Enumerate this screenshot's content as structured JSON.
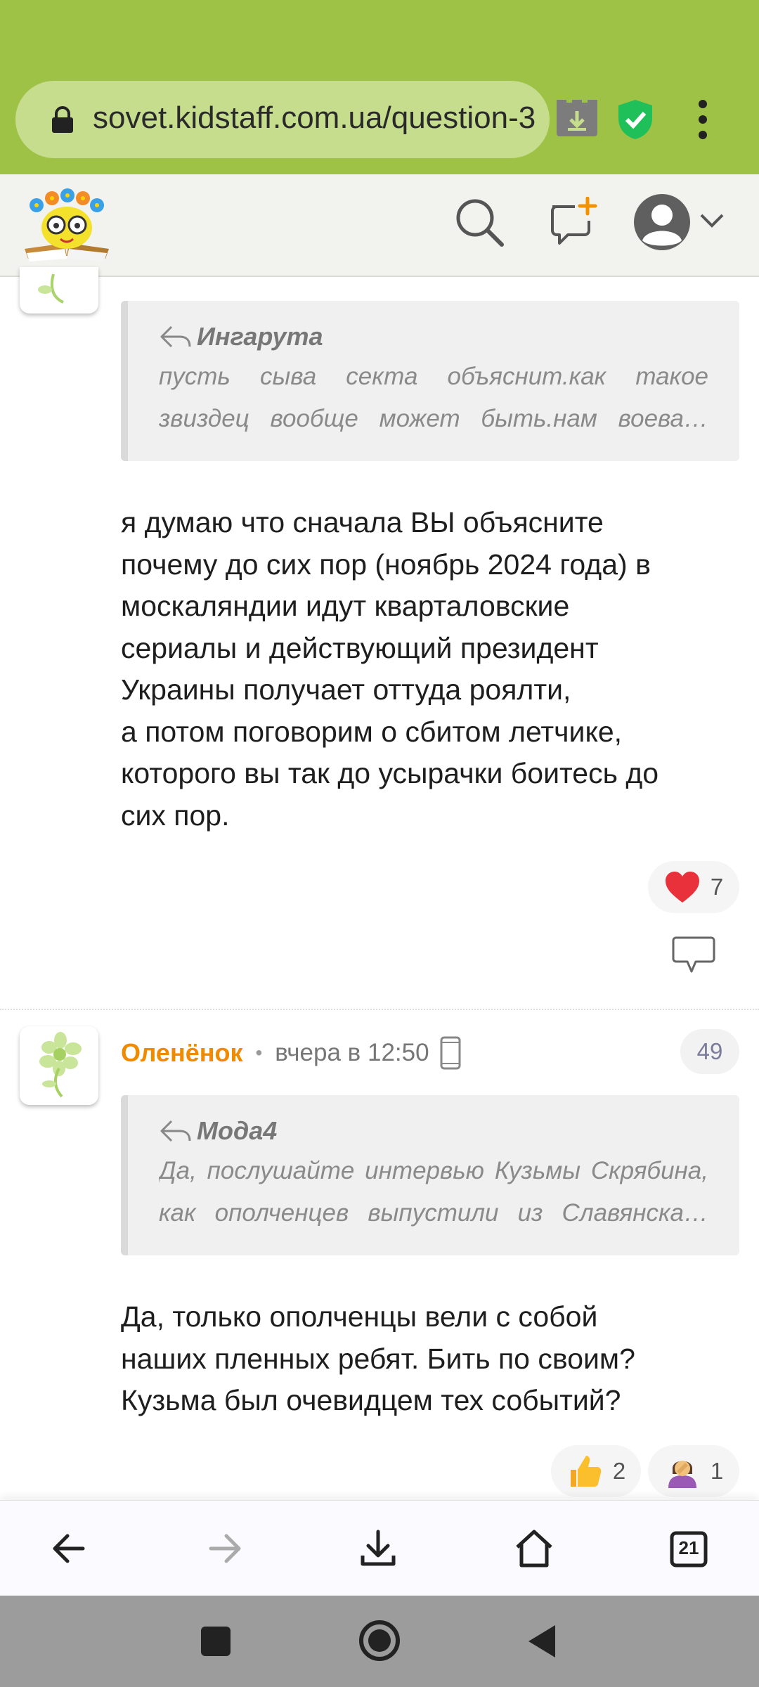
{
  "browser": {
    "url": "sovet.kidstaff.com.ua/question-3",
    "tab_count": "21"
  },
  "thread": {
    "post1": {
      "quote_author": "Ингарута",
      "quote_lines": [
        "пусть сыва секта объяснит.как такое",
        "звиздец вообще может быть.нам воева…"
      ],
      "body_lines": [
        "я думаю что сначала ВЫ объясните",
        "почему до сих пор (ноябрь 2024 года) в",
        "москаляндии идут кварталовские",
        "сериалы и действующий президент",
        "Украины получает оттуда роялти,",
        "а потом поговорим о сбитом летчике,",
        "которого вы так до усырачки боитесь до",
        "сих пор."
      ],
      "reaction_heart_count": "7"
    },
    "post2": {
      "username": "Оленёнок",
      "separator": "•",
      "timestamp": "вчера в 12:50",
      "post_number": "49",
      "quote_author": "Мода4",
      "quote_lines": [
        "Да, послушайте интервью Кузьмы Скрябина,",
        "как ополченцев выпустили из Славянска…"
      ],
      "body_lines": [
        "Да, только ополченцы вели с собой",
        "наших пленных ребят. Бить по своим?",
        "Кузьма был очевидцем тех событий?"
      ],
      "reaction_thumbs_count": "2",
      "reaction_facepalm_count": "1"
    }
  },
  "colors": {
    "browser_bar": "#9dc246",
    "username": "#f08a00",
    "accent_orange": "#f39200"
  }
}
